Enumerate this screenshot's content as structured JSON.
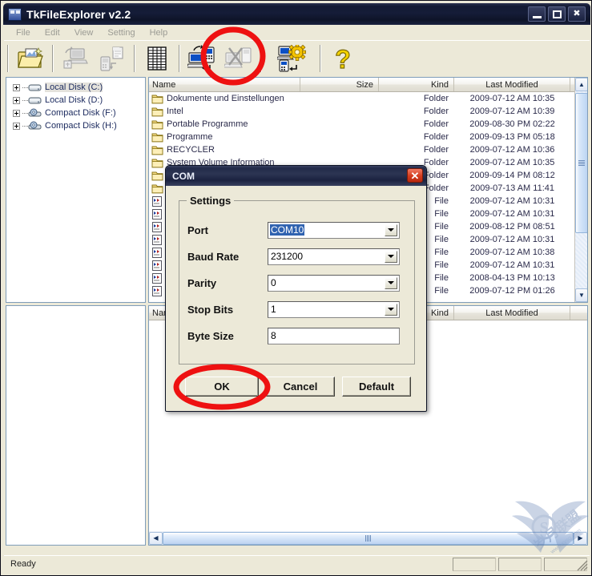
{
  "window": {
    "title": "TkFileExplorer v2.2",
    "icon": "app-icon",
    "buttons": {
      "minimize": "minimize-button",
      "maximize": "maximize-button",
      "close": "close-button"
    }
  },
  "menubar": {
    "items": [
      {
        "label": "File"
      },
      {
        "label": "Edit"
      },
      {
        "label": "View"
      },
      {
        "label": "Setting"
      },
      {
        "label": "Help"
      }
    ]
  },
  "toolbar": {
    "buttons": [
      {
        "name": "open-folder-icon",
        "title": "Open Folder"
      },
      {
        "name": "upload-to-pc-icon",
        "title": "Copy to PC"
      },
      {
        "name": "download-to-device-icon",
        "title": "Copy to Device"
      },
      {
        "name": "list-view-icon",
        "title": "List"
      },
      {
        "name": "connect-device-icon",
        "title": "Connect"
      },
      {
        "name": "disconnect-device-icon",
        "title": "Disconnect"
      },
      {
        "name": "device-settings-icon",
        "title": "Device Settings"
      },
      {
        "name": "help-question-icon",
        "title": "Help"
      }
    ]
  },
  "tree": {
    "items": [
      {
        "label": "Local Disk (C:)",
        "icon": "hard-disk-icon",
        "selected": true
      },
      {
        "label": "Local Disk (D:)",
        "icon": "hard-disk-icon",
        "selected": false
      },
      {
        "label": "Compact Disk (F:)",
        "icon": "cd-disk-icon",
        "selected": false
      },
      {
        "label": "Compact Disk (H:)",
        "icon": "cd-disk-icon",
        "selected": false
      }
    ]
  },
  "filelist": {
    "columns": [
      "Name",
      "Size",
      "Kind",
      "Last Modified"
    ],
    "rows": [
      {
        "name": "Dokumente und Einstellungen",
        "size": "",
        "kind": "Folder",
        "date": "2009-07-12 AM 10:35",
        "icon": "folder-icon"
      },
      {
        "name": "Intel",
        "size": "",
        "kind": "Folder",
        "date": "2009-07-12 AM 10:39",
        "icon": "folder-icon"
      },
      {
        "name": "Portable Programme",
        "size": "",
        "kind": "Folder",
        "date": "2009-08-30 PM 02:22",
        "icon": "folder-icon"
      },
      {
        "name": "Programme",
        "size": "",
        "kind": "Folder",
        "date": "2009-09-13 PM 05:18",
        "icon": "folder-icon"
      },
      {
        "name": "RECYCLER",
        "size": "",
        "kind": "Folder",
        "date": "2009-07-12 AM 10:36",
        "icon": "folder-icon"
      },
      {
        "name": "System Volume Information",
        "size": "",
        "kind": "Folder",
        "date": "2009-07-12 AM 10:35",
        "icon": "folder-icon"
      },
      {
        "name": "",
        "size": "",
        "kind": "Folder",
        "date": "2009-09-14 PM 08:12",
        "icon": "folder-icon"
      },
      {
        "name": "",
        "size": "",
        "kind": "Folder",
        "date": "2009-07-13 AM 11:41",
        "icon": "folder-icon"
      },
      {
        "name": "",
        "size": "",
        "kind": "File",
        "date": "2009-07-12 AM 10:31",
        "icon": "file-icon"
      },
      {
        "name": "",
        "size": "",
        "kind": "File",
        "date": "2009-07-12 AM 10:31",
        "icon": "file-icon"
      },
      {
        "name": "",
        "size": "",
        "kind": "File",
        "date": "2009-08-12 PM 08:51",
        "icon": "file-icon"
      },
      {
        "name": "",
        "size": "",
        "kind": "File",
        "date": "2009-07-12 AM 10:31",
        "icon": "file-icon"
      },
      {
        "name": "",
        "size": "",
        "kind": "File",
        "date": "2009-07-12 AM 10:38",
        "icon": "file-icon"
      },
      {
        "name": "",
        "size": "",
        "kind": "File",
        "date": "2009-07-12 AM 10:31",
        "icon": "file-icon"
      },
      {
        "name": "",
        "size": "",
        "kind": "File",
        "date": "2008-04-13 PM 10:13",
        "icon": "file-icon"
      },
      {
        "name": "",
        "size": "",
        "kind": "File",
        "date": "2009-07-12 PM 01:26",
        "icon": "file-icon"
      }
    ]
  },
  "filelist2": {
    "columns": [
      "Name",
      "Size",
      "Kind",
      "Last Modified"
    ],
    "rows": []
  },
  "dialog": {
    "title": "COM",
    "close_label": "✕",
    "legend": "Settings",
    "fields": [
      {
        "label": "Port",
        "value": "COM10",
        "type": "combo",
        "highlighted": true
      },
      {
        "label": "Baud Rate",
        "value": "231200",
        "type": "combo",
        "highlighted": false
      },
      {
        "label": "Parity",
        "value": "0",
        "type": "combo",
        "highlighted": false
      },
      {
        "label": "Stop Bits",
        "value": "1",
        "type": "combo",
        "highlighted": false
      },
      {
        "label": "Byte Size",
        "value": "8",
        "type": "textbox",
        "highlighted": false
      }
    ],
    "buttons": [
      {
        "label": "OK"
      },
      {
        "label": "Cancel"
      },
      {
        "label": "Default"
      }
    ]
  },
  "statusbar": {
    "text": "Ready"
  },
  "annotations": {
    "circle_toolbar": "red-circle-around-device-settings",
    "circle_ok": "red-circle-around-ok-button",
    "color": "#ee1111"
  },
  "watermark": {
    "text": "岁月联盟",
    "url": "www.sysg.com",
    "letter": "S"
  }
}
